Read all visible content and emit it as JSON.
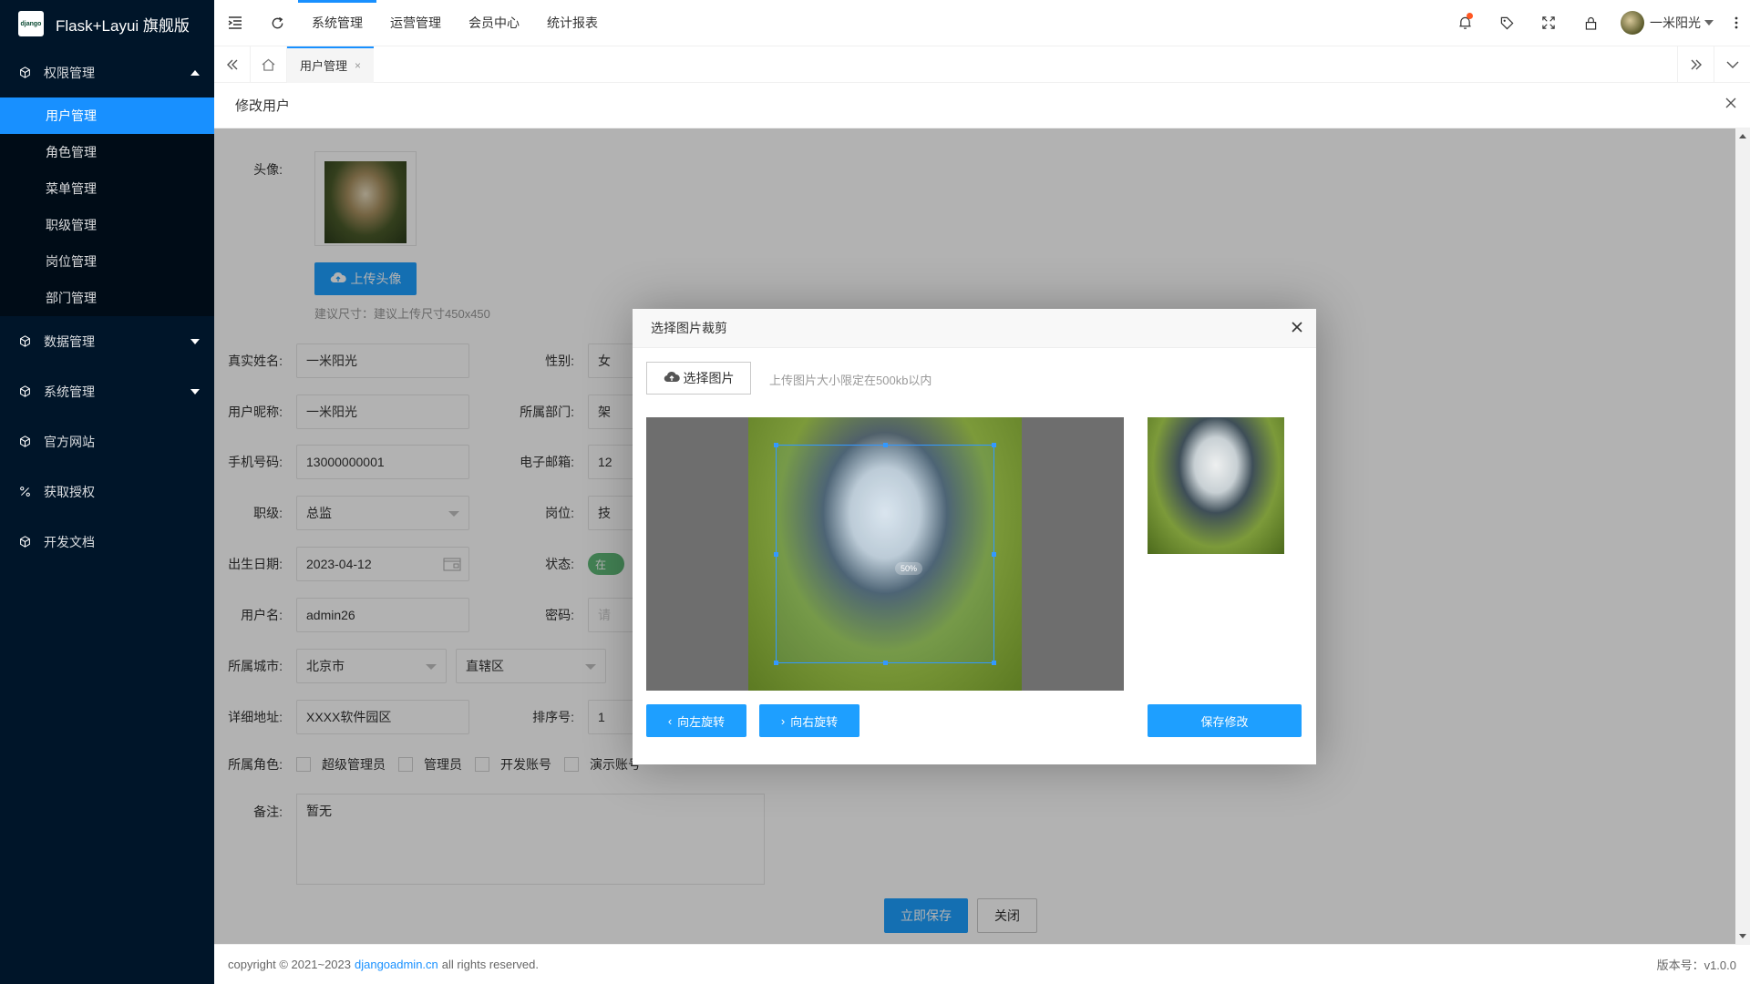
{
  "app": {
    "title": "Flask+Layui 旗舰版",
    "logo_text": "django"
  },
  "sidebar": {
    "groups": [
      {
        "label": "权限管理",
        "expanded": true,
        "items": [
          "用户管理",
          "角色管理",
          "菜单管理",
          "职级管理",
          "岗位管理",
          "部门管理"
        ]
      },
      {
        "label": "数据管理",
        "expanded": false
      },
      {
        "label": "系统管理",
        "expanded": false
      },
      {
        "label": "官方网站"
      },
      {
        "label": "获取授权"
      },
      {
        "label": "开发文档"
      }
    ]
  },
  "header": {
    "nav": [
      "系统管理",
      "运营管理",
      "会员中心",
      "统计报表"
    ],
    "username": "一米阳光"
  },
  "tabs": {
    "active": "用户管理"
  },
  "panel": {
    "title": "修改用户"
  },
  "form": {
    "avatar_label": "头像:",
    "upload_label": "上传头像",
    "upload_hint": "建议尺寸：建议上传尺寸450x450",
    "realname_label": "真实姓名:",
    "realname": "一米阳光",
    "gender_label": "性别:",
    "gender": "女",
    "nickname_label": "用户昵称:",
    "nickname": "一米阳光",
    "dept_label": "所属部门:",
    "dept": "架",
    "mobile_label": "手机号码:",
    "mobile": "13000000001",
    "email_label": "电子邮箱:",
    "email": "12",
    "level_label": "职级:",
    "level": "总监",
    "position_label": "岗位:",
    "position": "技",
    "birthday_label": "出生日期:",
    "birthday": "2023-04-12",
    "status_label": "状态:",
    "status": "在",
    "username_label": "用户名:",
    "username": "admin26",
    "password_label": "密码:",
    "password": "请",
    "city_label": "所属城市:",
    "province": "北京市",
    "district": "直辖区",
    "address_label": "详细地址:",
    "address": "XXXX软件园区",
    "sort_label": "排序号:",
    "sort": "1",
    "roles_label": "所属角色:",
    "roles": [
      "超级管理员",
      "管理员",
      "开发账号",
      "演示账号"
    ],
    "note_label": "备注:",
    "note": "暂无",
    "save_label": "立即保存",
    "close_label": "关闭"
  },
  "dialog": {
    "title": "选择图片裁剪",
    "choose_label": "选择图片",
    "hint": "上传图片大小限定在500kb以内",
    "rotate_left": "向左旋转",
    "rotate_right": "向右旋转",
    "save": "保存修改",
    "crop_ratio": "50%"
  },
  "footer": {
    "copyright_pre": "copyright © 2021~2023",
    "link": "djangoadmin.cn",
    "copyright_post": "all rights reserved.",
    "version": "版本号：v1.0.0"
  },
  "colors": {
    "sidebar": "#001529",
    "accent": "#1890ff",
    "button": "#1e9fff"
  }
}
